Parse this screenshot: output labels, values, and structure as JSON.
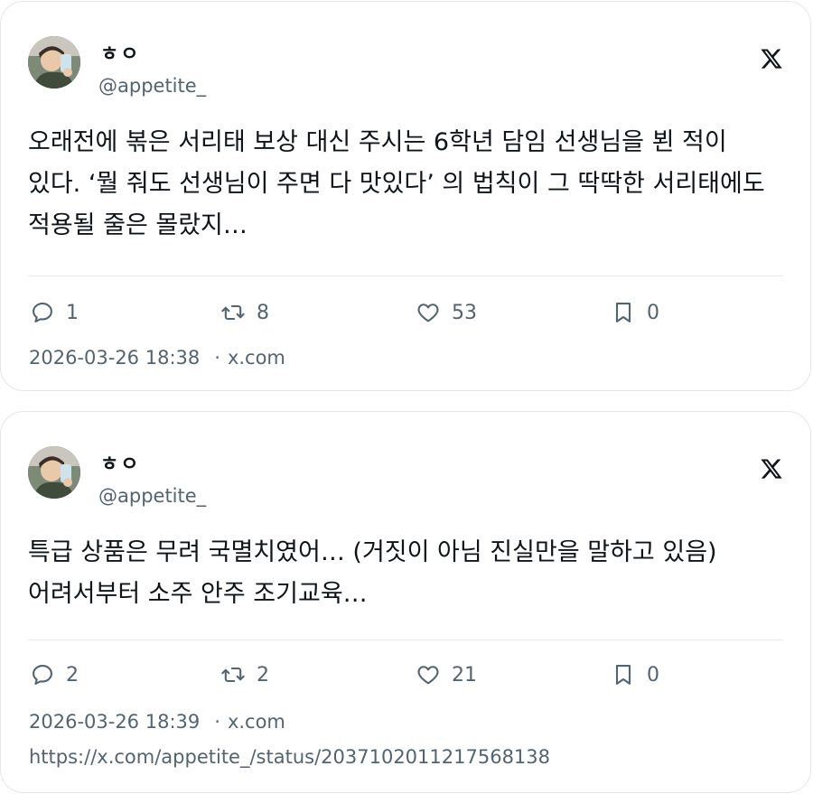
{
  "tweets": [
    {
      "author": {
        "name": "ㅎㅇ",
        "handle": "@appetite_"
      },
      "text": "오래전에 볶은 서리태 보상 대신 주시는 6학년 담임 선생님을 뵌 적이 있다. ‘뭘 줘도 선생님이 주면 다 맛있다’ 의 법칙이 그 딱딱한 서리태에도 적용될 줄은 몰랐지…",
      "stats": {
        "replies": "1",
        "retweets": "8",
        "likes": "53",
        "bookmarks": "0"
      },
      "timestamp": "2026-03-26 18:38",
      "separator": "·",
      "source": "x.com"
    },
    {
      "author": {
        "name": "ㅎㅇ",
        "handle": "@appetite_"
      },
      "text": "특급 상품은 무려 국멸치였어… (거짓이 아님 진실만을 말하고 있음) 어려서부터 소주 안주 조기교육…",
      "stats": {
        "replies": "2",
        "retweets": "2",
        "likes": "21",
        "bookmarks": "0"
      },
      "timestamp": "2026-03-26 18:39",
      "separator": "·",
      "source": "x.com",
      "url": "https://x.com/appetite_/status/2037102011217568138"
    }
  ],
  "icons": {
    "reply": "reply-icon",
    "retweet": "retweet-icon",
    "like": "heart-icon",
    "bookmark": "bookmark-icon",
    "brand": "x-logo-icon"
  },
  "colors": {
    "text": "#0f1419",
    "secondary": "#536471",
    "border": "#e1e8ed"
  }
}
